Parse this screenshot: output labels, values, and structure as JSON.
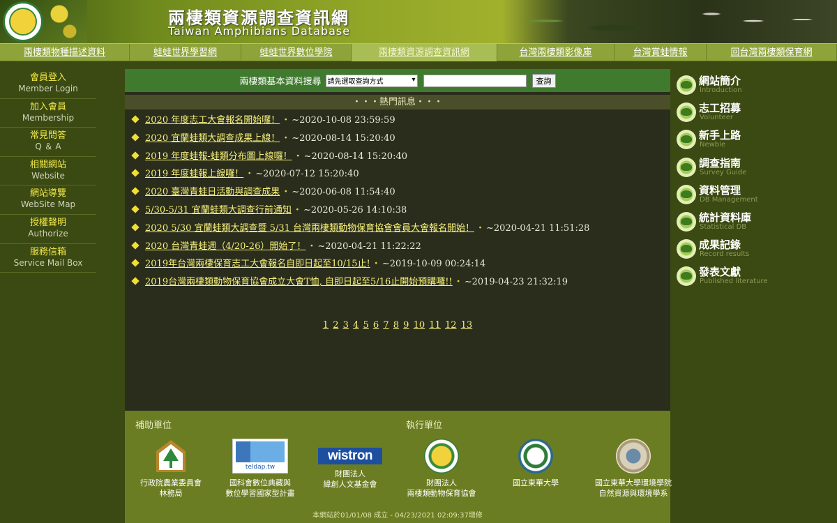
{
  "header": {
    "title": "兩棲類資源調查資訊網",
    "subtitle": "Taiwan Amphibians Database"
  },
  "nav": [
    {
      "label": "兩棲類物種描述資料",
      "width": 186,
      "active": false
    },
    {
      "label": "蛙蛙世界學習網",
      "width": 160,
      "active": false
    },
    {
      "label": "蛙蛙世界數位學院",
      "width": 158,
      "active": false
    },
    {
      "label": "兩棲類資源調查資訊網",
      "width": 209,
      "active": true
    },
    {
      "label": "台灣兩棲類影像庫",
      "width": 168,
      "active": false
    },
    {
      "label": "台灣賞蛙情報",
      "width": 132,
      "active": false
    },
    {
      "label": "回台灣兩棲類保育網",
      "width": 187,
      "active": false
    }
  ],
  "left_menu": [
    {
      "zh": "會員登入",
      "en": "Member Login"
    },
    {
      "zh": "加入會員",
      "en": "Membership"
    },
    {
      "zh": "常見問答",
      "en": "Q ＆ A"
    },
    {
      "zh": "相關網站",
      "en": "Website"
    },
    {
      "zh": "網站導覽",
      "en": "WebSite Map"
    },
    {
      "zh": "授權聲明",
      "en": "Authorize"
    },
    {
      "zh": "服務信箱",
      "en": "Service Mail Box"
    }
  ],
  "search": {
    "label": "兩棲類基本資料搜尋",
    "select_value": "請先選取查詢方式",
    "input_value": "",
    "button_label": "查詢"
  },
  "hot_news_header": "・・・熱門訊息・・・",
  "news": [
    {
      "title": "2020 年度志工大會報名開始囉！",
      "date": "~2020-10-08 23:59:59"
    },
    {
      "title": "2020 宜蘭蛙類大調查成果上線！",
      "date": "~2020-08-14 15:20:40"
    },
    {
      "title": "2019 年度蛙報-蛙類分布圖上線囉！",
      "date": "~2020-08-14 15:20:40"
    },
    {
      "title": "2019 年度蛙報上線囉！",
      "date": "~2020-07-12 15:20:40"
    },
    {
      "title": "2020 臺灣青蛙日活動與調查成果",
      "date": "~2020-06-08 11:54:40"
    },
    {
      "title": "5/30-5/31 宜蘭蛙類大調查行前通知",
      "date": "~2020-05-26 14:10:38"
    },
    {
      "title": "2020 5/30 宜蘭蛙類大調查暨 5/31 台灣兩棲類動物保育協會會員大會報名開始！",
      "date": "~2020-04-21 11:51:28"
    },
    {
      "title": "2020 台灣青蛙週（4/20-26）開始了！",
      "date": "~2020-04-21 11:22:22"
    },
    {
      "title": "2019年台灣兩棲保育志工大會報名自即日起至10/15止!",
      "date": "~2019-10-09 00:24:14"
    },
    {
      "title": "2019台灣兩棲類動物保育協會成立大會T恤, 自即日起至5/16止開始預購囉!!",
      "date": "~2019-04-23 21:32:19"
    }
  ],
  "pages": [
    "1",
    "2",
    "3",
    "4",
    "5",
    "6",
    "7",
    "8",
    "9",
    "10",
    "11",
    "12",
    "13"
  ],
  "footer": {
    "sponsor_label": "補助單位",
    "executor_label": "執行單位",
    "orgs": [
      {
        "line1": "行政院農業委員會",
        "line2": "林務局",
        "logo": "forestry-bureau-logo"
      },
      {
        "line1": "國科會數位典藏與",
        "line2": "數位學習國家型計畫",
        "logo": "teldap-logo",
        "logo_text": "teldap.tw"
      },
      {
        "line1": "財團法人",
        "line2": "緯創人文基金會",
        "logo": "wistron-logo",
        "logo_text": "wistron"
      },
      {
        "line1": "財團法人",
        "line2": "兩棲類動物保育協會",
        "logo": "amphibian-association-logo"
      },
      {
        "line1": "國立東華大學",
        "line2": "",
        "logo": "ndhu-logo"
      },
      {
        "line1": "國立東華大學環境學院",
        "line2": "自然資源與環境學系",
        "logo": "ndhu-env-logo"
      }
    ],
    "note": "本網站於01/01/08 成立 - 04/23/2021 02:09:37增修"
  },
  "right_menu": [
    {
      "zh": "網站簡介",
      "en": "Introduction"
    },
    {
      "zh": "志工招募",
      "en": "Volunteer"
    },
    {
      "zh": "新手上路",
      "en": "Newbie"
    },
    {
      "zh": "調查指南",
      "en": "Survey Guide"
    },
    {
      "zh": "資料管理",
      "en": "DB Management"
    },
    {
      "zh": "統計資料庫",
      "en": "Statistical DB"
    },
    {
      "zh": "成果記錄",
      "en": "Record results"
    },
    {
      "zh": "發表文獻",
      "en": "Published literature"
    }
  ]
}
